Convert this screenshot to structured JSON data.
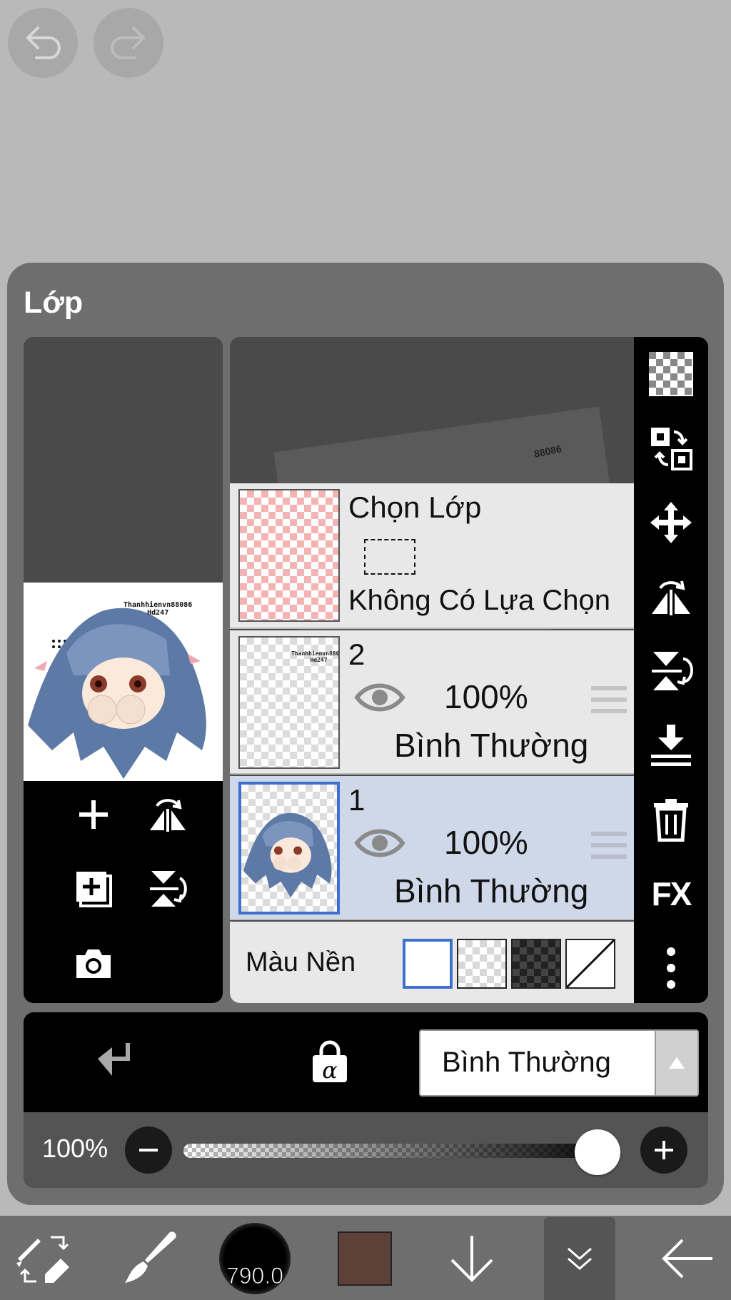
{
  "toolbar_top": {
    "undo_icon": "undo-icon",
    "redo_icon": "redo-icon"
  },
  "panel": {
    "title": "Lớp"
  },
  "preview": {
    "watermark": "Thanhhienvn88086\nHd247"
  },
  "left_tools": {
    "add_layer_icon": "plus-icon",
    "flip_horizontal_icon": "flip-horizontal-icon",
    "duplicate_layer_icon": "duplicate-icon",
    "flip_vertical_icon": "flip-vertical-icon",
    "camera_icon": "camera-icon"
  },
  "layers_bg_watermark": "88086",
  "selection_layer": {
    "title": "Chọn Lớp",
    "status": "Không Có Lựa Chọn"
  },
  "layers": [
    {
      "name": "2",
      "opacity": "100%",
      "blend": "Bình Thường",
      "selected": false,
      "watermark": "Thanhhienvn88086\nHd247"
    },
    {
      "name": "1",
      "opacity": "100%",
      "blend": "Bình Thường",
      "selected": true
    }
  ],
  "background_color": {
    "label": "Màu Nền",
    "options": [
      "white",
      "light-checker",
      "dark-checker",
      "none"
    ],
    "selected": "white"
  },
  "right_tools": [
    "transparency-icon",
    "swap-layers-icon",
    "move-icon",
    "flip-horizontal-icon",
    "flip-vertical-icon",
    "merge-down-icon",
    "trash-icon",
    "FX",
    "more-icon"
  ],
  "props": {
    "clip_icon": "clip-icon",
    "alpha_lock_icon": "alpha-lock-icon",
    "blend_mode": "Bình Thường"
  },
  "opacity_slider": {
    "value_text": "100%",
    "value": 1.0
  },
  "bottom": {
    "brush_size": "790.0",
    "current_color": "#5d4037"
  },
  "colors": {
    "accent": "#3e6fd0",
    "selected_row": "#cfd8e8",
    "panel": "#6e6e6e"
  }
}
